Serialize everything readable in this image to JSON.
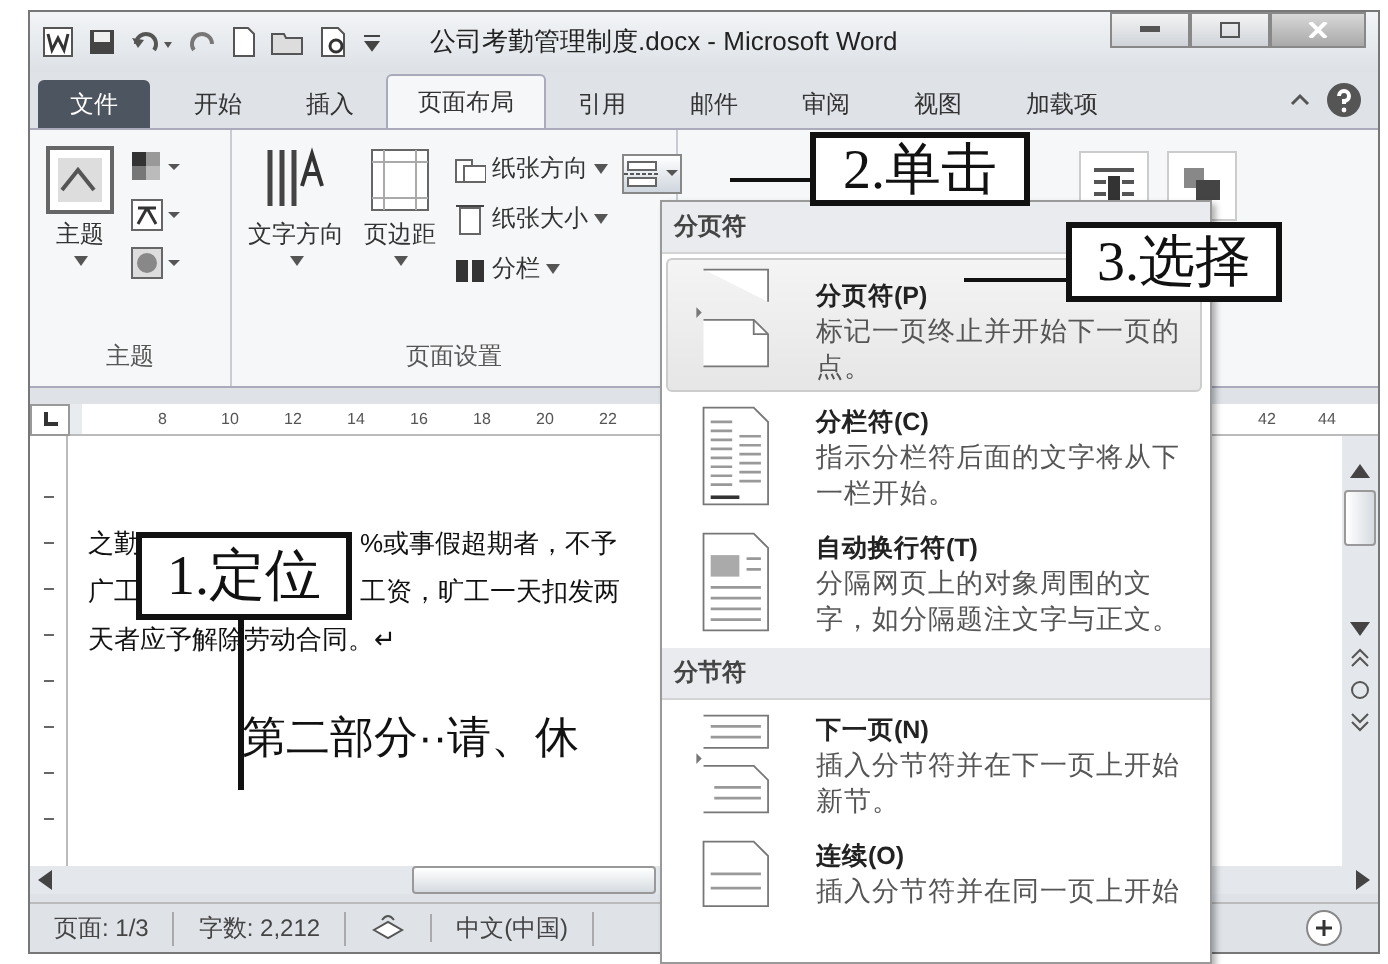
{
  "window": {
    "title": "公司考勤管理制度.docx - Microsoft Word"
  },
  "ribbon_tabs": [
    {
      "label": "文件",
      "kind": "file",
      "selected": false
    },
    {
      "label": "开始",
      "kind": "tab",
      "selected": false
    },
    {
      "label": "插入",
      "kind": "tab",
      "selected": false
    },
    {
      "label": "页面布局",
      "kind": "tab",
      "selected": true
    },
    {
      "label": "引用",
      "kind": "tab",
      "selected": false
    },
    {
      "label": "邮件",
      "kind": "tab",
      "selected": false
    },
    {
      "label": "审阅",
      "kind": "tab",
      "selected": false
    },
    {
      "label": "视图",
      "kind": "tab",
      "selected": false
    },
    {
      "label": "加载项",
      "kind": "tab",
      "selected": false
    }
  ],
  "theme_group": {
    "label": "主题",
    "theme_button": "主题"
  },
  "page_setup_group": {
    "label": "页面设置",
    "large_buttons": [
      "文字方向",
      "页边距"
    ],
    "small_buttons": [
      "纸张方向",
      "纸张大小",
      "分栏"
    ],
    "breaks_button": {
      "pressed": true
    }
  },
  "ruler": {
    "left_numbers": [
      "8",
      "10",
      "12",
      "14",
      "16",
      "18",
      "20",
      "22"
    ],
    "right_numbers": [
      "42",
      "44"
    ]
  },
  "document": {
    "lines": [
      {
        "segments": [
          "之勤",
          "%或事假超期者，不予"
        ]
      },
      {
        "segments": [
          "广工",
          "工资，旷工一天扣发两"
        ]
      },
      {
        "segments": [
          "天者应予解除劳动合同。↵"
        ]
      }
    ],
    "heading": "第二部分··请、休"
  },
  "status_bar": {
    "page": "页面: 1/3",
    "words": "字数: 2,212",
    "language": "中文(中国)"
  },
  "breaks_menu": {
    "sections": [
      {
        "title": "分页符",
        "items": [
          {
            "kind": "page",
            "title": "分页符(P)",
            "description": "标记一页终止并开始下一页的点。",
            "selected": true
          },
          {
            "kind": "column",
            "title": "分栏符(C)",
            "description": "指示分栏符后面的文字将从下一栏开始。",
            "selected": false
          },
          {
            "kind": "wrap",
            "title": "自动换行符(T)",
            "description": "分隔网页上的对象周围的文字，如分隔题注文字与正文。",
            "selected": false
          }
        ]
      },
      {
        "title": "分节符",
        "items": [
          {
            "kind": "next",
            "title": "下一页(N)",
            "description": "插入分节符并在下一页上开始新节。",
            "selected": false
          },
          {
            "kind": "continuous",
            "title": "连续(O)",
            "description": "插入分节符并在同一页上开始",
            "selected": false
          }
        ]
      }
    ]
  },
  "callouts": [
    {
      "text": "2.单击"
    },
    {
      "text": "3.选择"
    },
    {
      "text": "1.定位"
    }
  ]
}
